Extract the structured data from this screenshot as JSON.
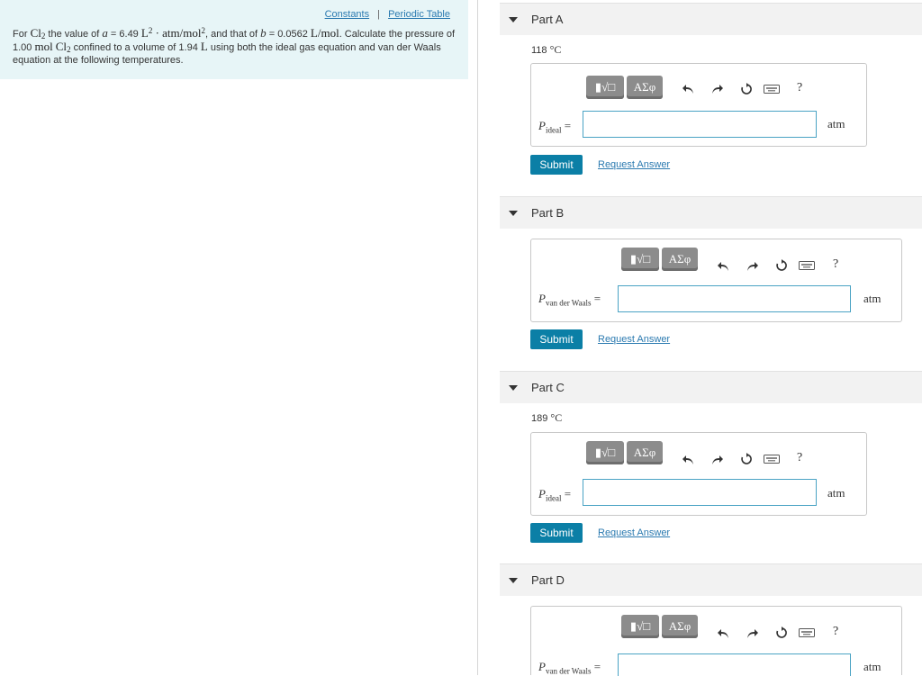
{
  "left_panel": {
    "links": [
      "Constants",
      "Periodic Table"
    ],
    "separator": "|",
    "problem": {
      "t1": "For ",
      "cl2_a": "Cl",
      "cl2_a_sub": "2",
      "t2": " the value of ",
      "a": "a",
      "t3": " = 6.49 ",
      "unit_a1": "L",
      "unit_a1_sup": "2",
      "unit_a2": " · atm/mol",
      "unit_a2_sup": "2",
      "t4": ", and that of ",
      "b": "b",
      "t5": " = 0.0562 ",
      "unit_b": "L/mol",
      "t6": ". Calculate the pressure of 1.00 ",
      "mol": "mol",
      "t6b": " ",
      "cl2_b": "Cl",
      "cl2_b_sub": "2",
      "t7": " confined to a volume of 1.94 ",
      "L": "L",
      "t8": " using both the ideal gas equation and van der Waals equation at the following temperatures."
    }
  },
  "toolbar": {
    "templates_label": "▮√□",
    "greek_label": "ΑΣφ",
    "help_label": "?"
  },
  "parts": [
    {
      "title": "Part A",
      "temp_value": "118",
      "temp_unit": "°C",
      "var": "P",
      "sub": "ideal",
      "eq": "=",
      "unit": "atm",
      "submit": "Submit",
      "request": "Request Answer"
    },
    {
      "title": "Part B",
      "var": "P",
      "sub": "van der Waals",
      "eq": "=",
      "unit": "atm",
      "submit": "Submit",
      "request": "Request Answer"
    },
    {
      "title": "Part C",
      "temp_value": "189",
      "temp_unit": "°C",
      "var": "P",
      "sub": "ideal",
      "eq": "=",
      "unit": "atm",
      "submit": "Submit",
      "request": "Request Answer"
    },
    {
      "title": "Part D",
      "var": "P",
      "sub": "van der Waals",
      "eq": "=",
      "unit": "atm"
    }
  ]
}
